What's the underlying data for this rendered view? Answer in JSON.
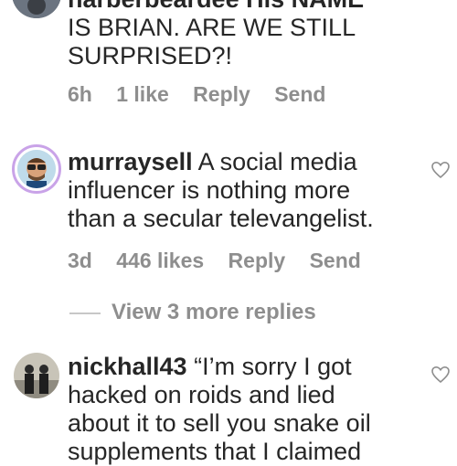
{
  "comments": [
    {
      "username": "harberbeardee",
      "text": "His NAME IS BRIAN. ARE WE STILL SURPRISED?!",
      "lines": [
        "harberbeardee His NAME",
        "IS BRIAN. ARE WE STILL",
        "SURPRISED?!"
      ],
      "time": "6h",
      "likes": "1 like",
      "reply": "Reply",
      "send": "Send"
    },
    {
      "username": "murraysell",
      "text": "A social media influencer is nothing more than a secular televangelist.",
      "line1_rest": "A social media",
      "line2": "influencer is nothing more",
      "line3": "than a secular televangelist.",
      "time": "3d",
      "likes": "446 likes",
      "reply": "Reply",
      "send": "Send",
      "view_replies": "View 3 more replies"
    },
    {
      "username": "nickhall43",
      "line1_rest": "“I’m sorry I got",
      "line2": "hacked on roids and lied",
      "line3": "about it to sell you snake oil",
      "line4": "supplements that I claimed"
    }
  ],
  "icons": {
    "like": "heart-outline-icon"
  },
  "colors": {
    "text": "#262626",
    "meta": "#8e8e8e",
    "avatar_ring": "#c9a3e8"
  }
}
